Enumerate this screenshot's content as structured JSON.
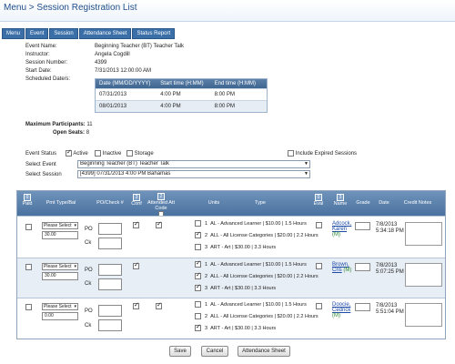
{
  "header": {
    "menu_label": "Menu",
    "separator": ">",
    "title": "Session Registration List"
  },
  "tabs": [
    "Menu",
    "Event",
    "Session",
    "Attendance Sheet",
    "Status Report"
  ],
  "session_info": {
    "event_name_label": "Event Name:",
    "event_name": "Beginning Teacher (BT) Teacher Talk",
    "instructor_label": "Instructor:",
    "instructor": "Angela Cogdill",
    "session_number_label": "Session Number:",
    "session_number": "4399",
    "start_date_label": "Start Date:",
    "start_date": "7/31/2013 12:00:00 AM",
    "scheduled_label": "Scheduled Date/s:"
  },
  "schedule": {
    "headers": [
      "Date (MM/DD/YYYY)",
      "Start time (H:MM)",
      "End time (H:MM)"
    ],
    "rows": [
      [
        "07/31/2013",
        "4:00 PM",
        "8:00 PM"
      ],
      [
        "08/01/2013",
        "4:00 PM",
        "8:00 PM"
      ]
    ]
  },
  "capacity": {
    "max_label": "Maximum Participants:",
    "max_value": "11",
    "open_label": "Open Seats:",
    "open_value": "8"
  },
  "filters": {
    "event_status_label": "Event Status",
    "active": "Active",
    "inactive": "Inactive",
    "storage": "Storage",
    "include_expired": "Include Expired Sessions",
    "select_event_label": "Select Event",
    "select_event_value": "Beginning Teacher (BT) Teacher Talk",
    "select_session_label": "Select Session",
    "select_session_value": "[4399] 07/31/2013 4:00 PM Bahamas"
  },
  "grid": {
    "headers": {
      "paid_count": "0",
      "paid": "Paid",
      "pmt_type": "Pmt Type/Bal",
      "po_check": "PO/Check #",
      "conf_count": "3",
      "conf": "Conf",
      "att_count": "2",
      "attended": "Attended Att Code",
      "units": "Units",
      "type": "Type",
      "eval_count": "0",
      "eval": "Eval",
      "name_count": "3",
      "name": "Name",
      "grade": "Grade",
      "date": "Date",
      "credit_notes": "Credit Notes"
    },
    "rows": [
      {
        "pmt_select": "Please Select",
        "balance": "30.00",
        "po_label": "PO",
        "ck_label": "Ck",
        "units": [
          {
            "num": "1",
            "text": "AL - Advanced Learner | $10.00 | 1.5 Hours"
          },
          {
            "num": "2",
            "text": "ALL - All License Categories | $20.00 | 2.2 Hours"
          },
          {
            "num": "3",
            "text": "ART - Art | $30.00 | 3.3 Hours"
          }
        ],
        "name_last": "Adcock,",
        "name_first": "Karen",
        "name_tag": "(M)",
        "date": "7/8/2013",
        "time": "5:34:18 PM"
      },
      {
        "pmt_select": "Please Select",
        "balance": "30.00",
        "po_label": "PO",
        "ck_label": "Ck",
        "units": [
          {
            "num": "1",
            "text": "AL - Advanced Learner | $10.00 | 1.5 Hours"
          },
          {
            "num": "2",
            "text": "ALL - All License Categories | $20.00 | 2.2 Hours"
          },
          {
            "num": "3",
            "text": "ART - Art | $30.00 | 3.3 Hours"
          }
        ],
        "name_last": "Brown,",
        "name_first": "Cris",
        "name_tag": "(M)",
        "date": "7/8/2013",
        "time": "5:07:25 PM"
      },
      {
        "pmt_select": "Please Select",
        "balance": "0.00",
        "po_label": "PO",
        "ck_label": "Ck",
        "units": [
          {
            "num": "1",
            "text": "AL - Advanced Learner | $10.00 | 1.5 Hours"
          },
          {
            "num": "2",
            "text": "ALL - All License Categories | $20.00 | 2.2 Hours"
          },
          {
            "num": "3",
            "text": "ART - Art | $30.00 | 3.3 Hours"
          }
        ],
        "name_last": "Doocie,",
        "name_first": "Cedrick",
        "name_tag": "(M)",
        "date": "7/8/2013",
        "time": "5:51:04 PM"
      }
    ]
  },
  "buttons": {
    "save": "Save",
    "cancel": "Cancel",
    "attendance": "Attendance Sheet"
  }
}
